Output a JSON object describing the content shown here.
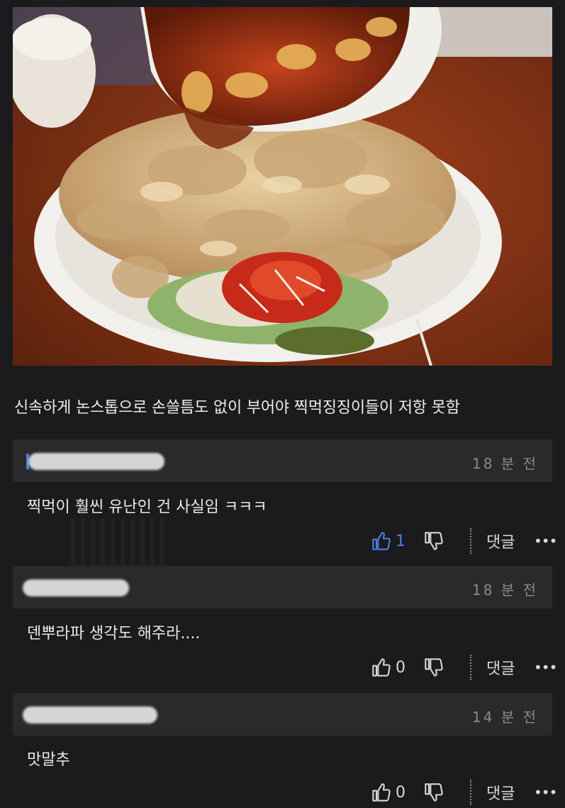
{
  "post": {
    "caption": "신속하게 논스톱으로 손쓸틈도 없이 부어야 찍먹징징이들이 저항 못함"
  },
  "comments": [
    {
      "time": "18 분 전",
      "text": "찍먹이 훨씬 유난인 건 사실임 ㅋㅋㅋ",
      "like_count": "1",
      "liked": true,
      "reply_label": "댓글",
      "more_label": "•••"
    },
    {
      "time": "18 분 전",
      "text": "덴뿌라파 생각도 해주라....",
      "like_count": "0",
      "liked": false,
      "reply_label": "댓글",
      "more_label": "•••"
    },
    {
      "time": "14 분 전",
      "text": "맛말추",
      "like_count": "0",
      "liked": false,
      "reply_label": "댓글",
      "more_label": "•••"
    }
  ],
  "colors": {
    "background": "#1b1b1d",
    "header_bg": "#2a2a2d",
    "liked_accent": "#4b7fe3",
    "time_text": "#8a8a8f"
  },
  "icons": {
    "like": "thumbs-up-icon",
    "dislike": "thumbs-down-icon",
    "more": "more-dots-icon"
  }
}
